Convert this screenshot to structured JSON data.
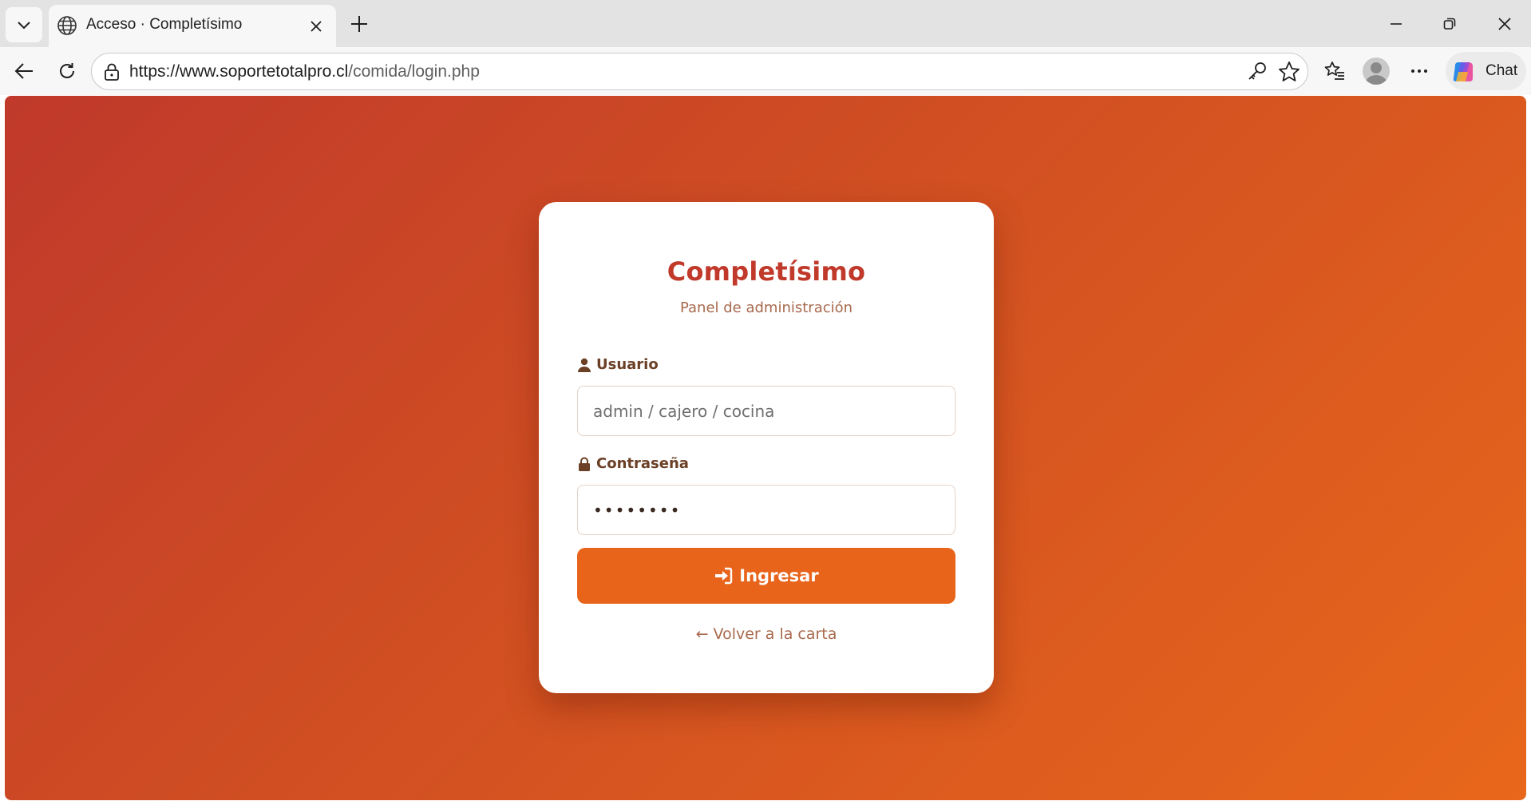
{
  "browser": {
    "tab_title": "Acceso · Completísimo",
    "url_host": "https://www.soportetotalpro.cl",
    "url_path": "/comida/login.php",
    "chat_label": "Chat"
  },
  "login": {
    "brand": "Completísimo",
    "subtitle": "Panel de administración",
    "username_label": "Usuario",
    "username_placeholder": "admin / cajero / cocina",
    "password_label": "Contraseña",
    "password_value": "••••••••",
    "submit_label": "Ingresar",
    "back_link": "← Volver a la carta"
  },
  "colors": {
    "brand": "#c0392b",
    "accent": "#e8641b",
    "label": "#6b4027",
    "muted": "#a86a4e"
  },
  "icons": {
    "username": "user-icon",
    "password": "lock-icon",
    "submit": "sign-in-icon"
  }
}
